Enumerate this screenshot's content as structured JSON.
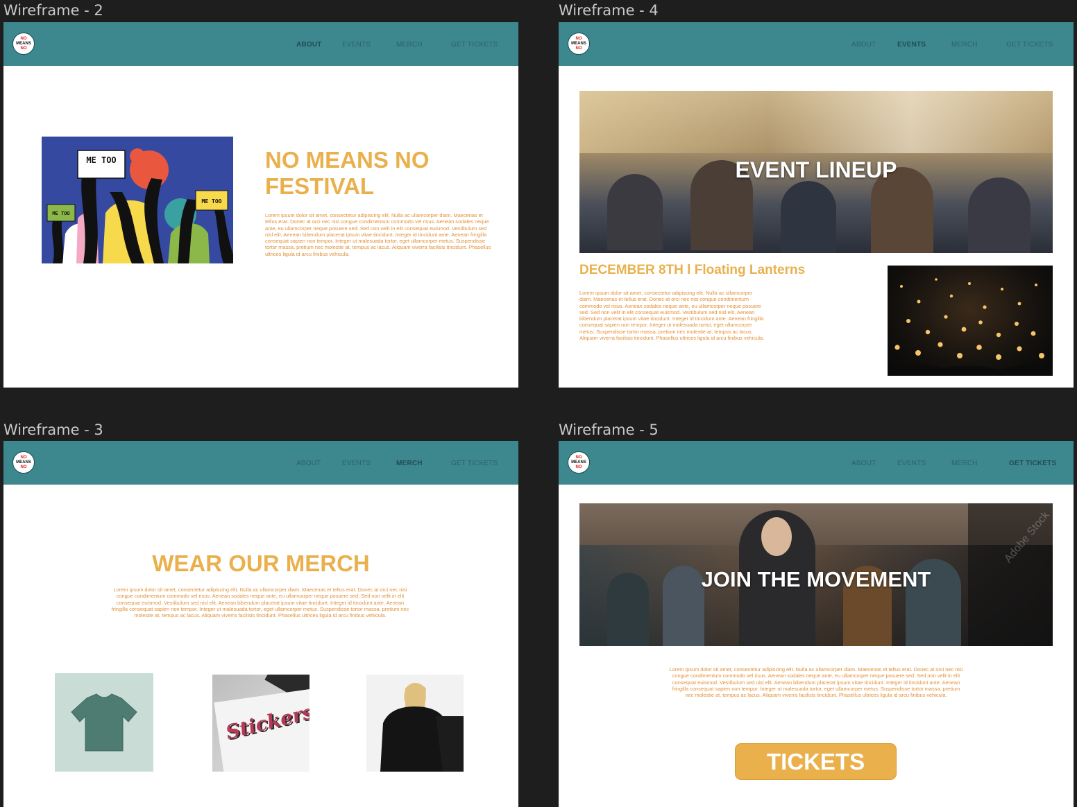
{
  "frames": {
    "f2": {
      "title": "Wireframe - 2"
    },
    "f3": {
      "title": "Wireframe - 3"
    },
    "f4": {
      "title": "Wireframe - 4"
    },
    "f5": {
      "title": "Wireframe - 5"
    }
  },
  "logo": {
    "line1": "NO",
    "line2": "MEANS",
    "line3": "NO"
  },
  "nav": {
    "about": "ABOUT",
    "events": "EVENTS",
    "merch": "MERCH",
    "tickets": "GET TICKETS"
  },
  "about": {
    "poster_sign_big": "ME TOO",
    "poster_sign_small_left": "ME TOO",
    "poster_sign_small_right": "ME TOO",
    "title_line1": "NO MEANS NO",
    "title_line2": "FESTIVAL",
    "body": "Lorem ipsum dolor sit amet, consectetur adipiscing elit. Nulla ac ullamcorper diam. Maecenas et tellus erat. Donec at orci nec nisi congue condimentum commodo vel risus. Aenean sodales neque ante, eu ullamcorper neque posuere sed. Sed non velit in elit consequat euismod. Vestibulum sed nisl elit. Aenean bibendum placerat ipsum vitae tincidunt. Integer id tincidunt ante. Aenean fringilla consequat sapien non tempor. Integer ut malesuada tortor, eget ullamcorper metus. Suspendisse tortor massa, pretium nec molestie at, tempus ac lacus. Aliquam viverra facilisis tincidunt. Phasellus ultrices ligula id arcu finibus vehicula."
  },
  "events": {
    "hero": "EVENT LINEUP",
    "date_title": "DECEMBER 8TH l Floating Lanterns",
    "body": "Lorem ipsum dolor sit amet, consectetur adipiscing elit. Nulla ac ullamcorper diam. Maecenas et tellus erat. Donec at orci nec nisi congue condimentum commodo vel risus. Aenean sodales neque ante, eu ullamcorper neque posuere sed. Sed non velit in elit consequat euismod. Vestibulum sed nisl elit. Aenean bibendum placerat ipsum vitae tincidunt. Integer id tincidunt ante. Aenean fringilla consequat sapien non tempor. Integer ut malesuada tortor, eget ullamcorper metus. Suspendisse tortor massa, pretium nec molestie at, tempus ac lacus. Aliquam viverra facilisis tincidunt. Phasellus ultrices ligula id arcu finibus vehicula."
  },
  "merch": {
    "title": "WEAR OUR MERCH",
    "body": "Lorem ipsum dolor sit amet, consectetur adipiscing elit. Nulla ac ullamcorper diam. Maecenas et tellus erat. Donec at orci nec nisi congue condimentum commodo vel risus. Aenean sodales neque ante, eu ullamcorper neque posuere sed. Sed non velit in elit consequat euismod. Vestibulum sed nisl elit. Aenean bibendum placerat ipsum vitae tincidunt. Integer id tincidunt ante. Aenean fringilla consequat sapien non tempor. Integer ut malesuada tortor, eget ullamcorper metus. Suspendisse tortor massa, pretium nec molestie at, tempus ac lacus. Aliquam viverra facilisis tincidunt. Phasellus ultrices ligula id arcu finibus vehicula.",
    "sticker_text": "Stickers"
  },
  "tickets": {
    "hero": "JOIN THE MOVEMENT",
    "watermark": "Adobe Stock",
    "body": "Lorem ipsum dolor sit amet, consectetur adipiscing elit. Nulla ac ullamcorper diam. Maecenas et tellus erat. Donec at orci nec nisi congue condimentum commodo vel risus. Aenean sodales neque ante, eu ullamcorper neque posuere sed. Sed non velit in elit consequat euismod. Vestibulum sed nisl elit. Aenean bibendum placerat ipsum vitae tincidunt. Integer id tincidunt ante. Aenean fringilla consequat sapien non tempor. Integer ut malesuada tortor, eget ullamcorper metus. Suspendisse tortor massa, pretium nec molestie at, tempus ac lacus. Aliquam viverra facilisis tincidunt. Phasellus ultrices ligula id arcu finibus vehicula.",
    "button": "TICKETS"
  },
  "colors": {
    "teal": "#3d878f",
    "gold": "#e9b04c",
    "lorem": "#e0913a",
    "canvas": "#1e1e1e"
  }
}
